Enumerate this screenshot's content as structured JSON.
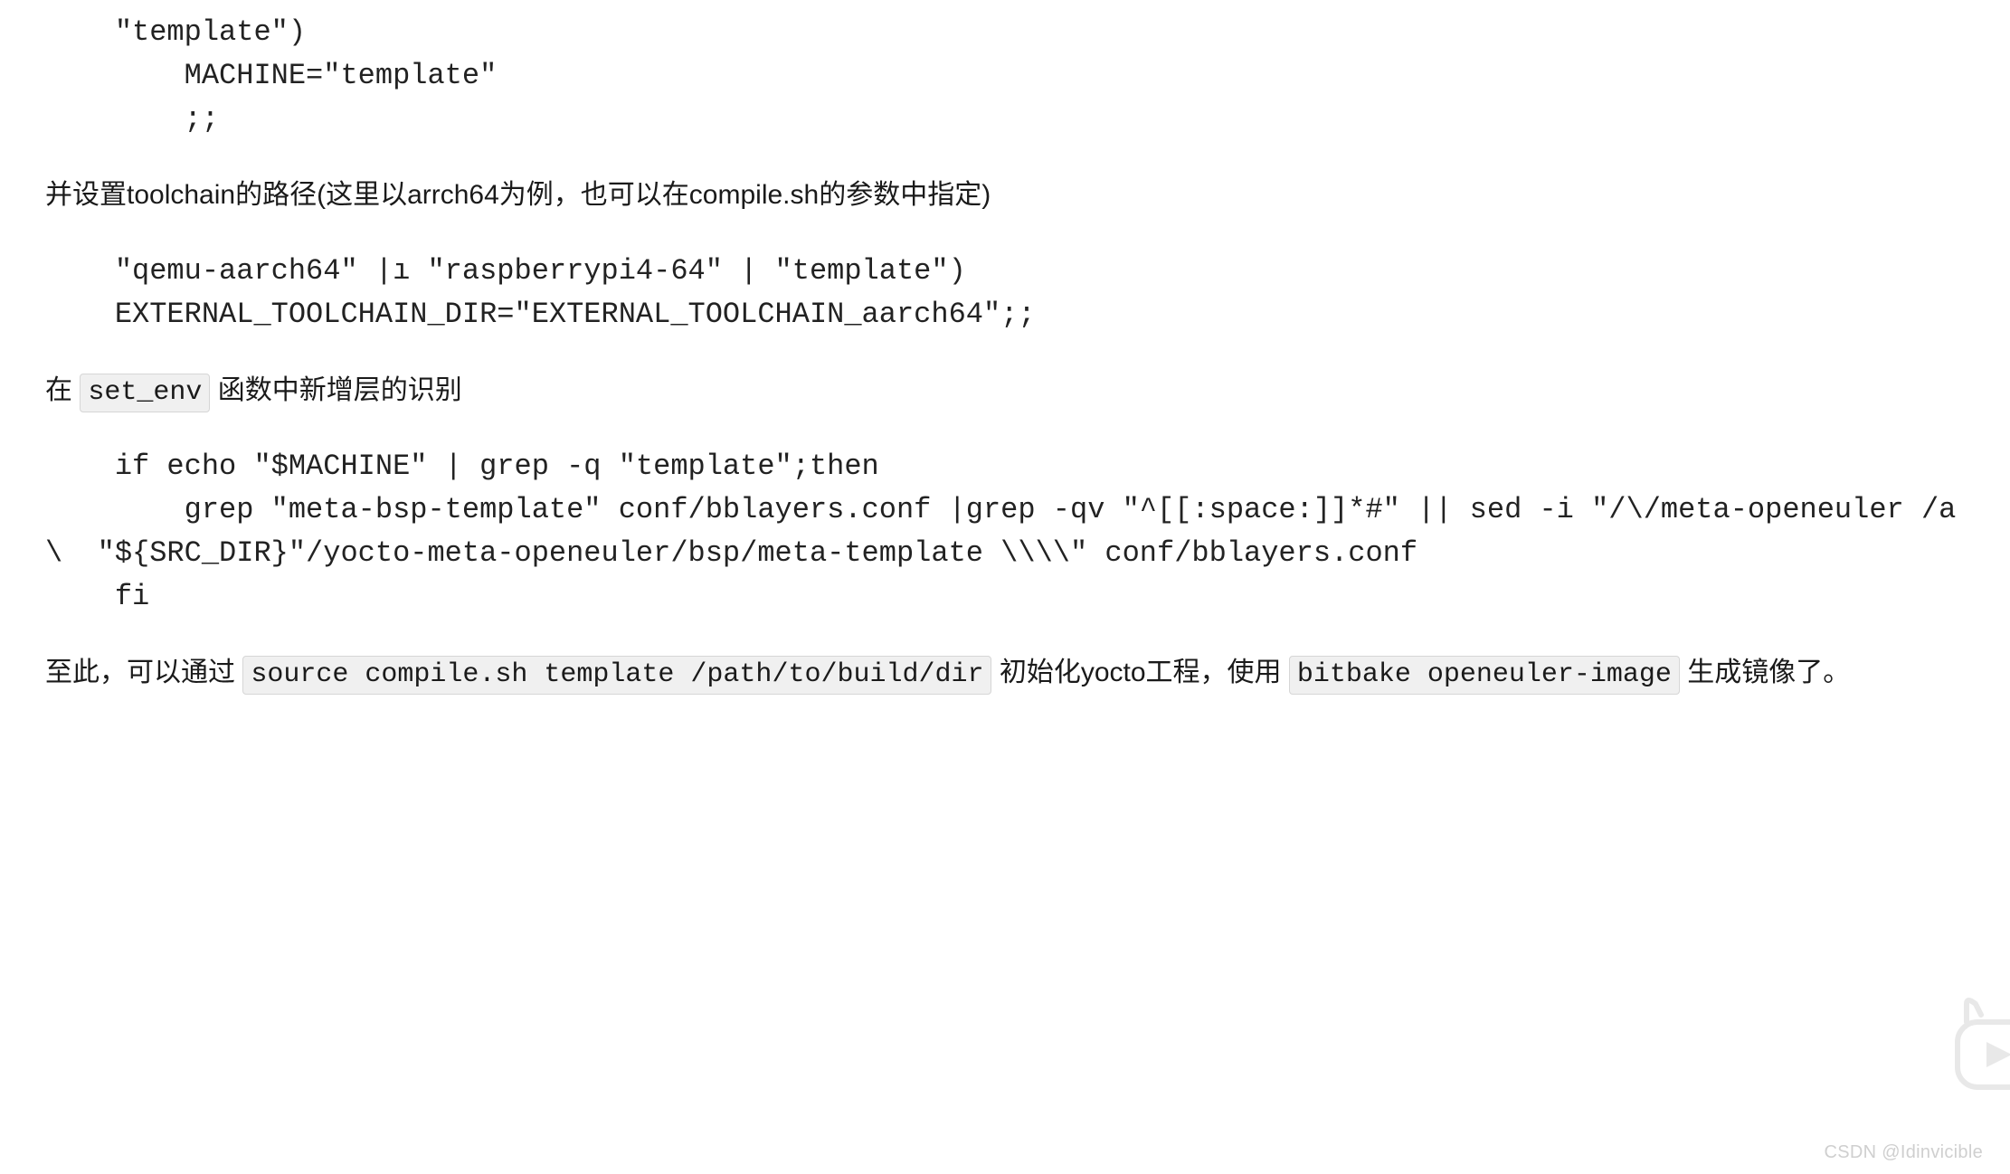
{
  "code_block_1": "    \"template\")\n        MACHINE=\"template\"\n        ;;",
  "para_1": "并设置toolchain的路径(这里以arrch64为例，也可以在compile.sh的参数中指定)",
  "code_block_2": "    \"qemu-aarch64\" |ı \"raspberrypi4-64\" | \"template\")\n    EXTERNAL_TOOLCHAIN_DIR=\"EXTERNAL_TOOLCHAIN_aarch64\";;",
  "para_2_pre": "在 ",
  "para_2_code": "set_env",
  "para_2_post": " 函数中新增层的识别",
  "code_block_3": "    if echo \"$MACHINE\" | grep -q \"template\";then\n        grep \"meta-bsp-template\" conf/bblayers.conf |grep -qv \"^[[:space:]]*#\" || sed -i \"/\\/meta-openeuler /a \\  \"${SRC_DIR}\"/yocto-meta-openeuler/bsp/meta-template \\\\\\\\\" conf/bblayers.conf\n    fi",
  "para_3_pre": "至此，可以通过 ",
  "para_3_code1": "source compile.sh template /path/to/build/dir",
  "para_3_mid": " 初始化yocto工程，使用 ",
  "para_3_code2": "bitbake openeuler-image",
  "para_3_post": " 生成镜像了。",
  "watermark": "CSDN @Idinvicible"
}
